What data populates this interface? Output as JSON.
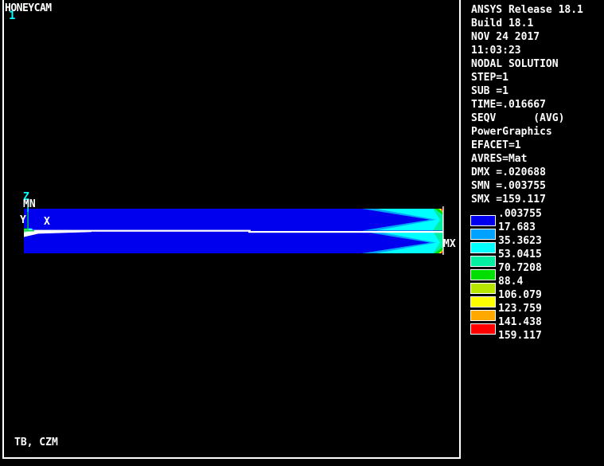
{
  "watermark": "HONEYCAM",
  "plot_number": "1",
  "footer_title": "TB, CZM",
  "info_panel": {
    "lines": [
      "ANSYS Release 18.1",
      "Build 18.1",
      "NOV 24 2017",
      "11:03:23",
      "NODAL SOLUTION",
      "STEP=1",
      "SUB =1",
      "TIME=.016667",
      "SEQV      (AVG)",
      "PowerGraphics",
      "EFACET=1",
      "AVRES=Mat",
      "DMX =.020688",
      "SMN =.003755",
      "SMX =159.117"
    ]
  },
  "legend": {
    "values": [
      ".003755",
      "17.683",
      "35.3623",
      "53.0415",
      "70.7208",
      "88.4",
      "106.079",
      "123.759",
      "141.438",
      "159.117"
    ],
    "colors": [
      "#0000EE",
      "#00A2FF",
      "#00FFFF",
      "#00EEA0",
      "#00DD00",
      "#B9E600",
      "#FFFF00",
      "#FFA800",
      "#FF0000"
    ]
  },
  "model_labels": {
    "mn": "MN",
    "mx": "MX",
    "triad_x": "X",
    "triad_y": "Y",
    "triad_z": "Z"
  },
  "colors": {
    "background": "#000000",
    "frame": "#FFFFFF",
    "text": "#FFFFFF",
    "accent_cyan": "#00FFFF",
    "beam_base": "#0000EE"
  }
}
